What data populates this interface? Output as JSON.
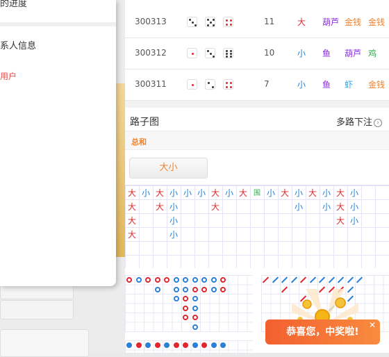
{
  "drawer": {
    "item1": "的进度",
    "item2": "系人信息",
    "item3": "用户"
  },
  "results": [
    {
      "id": "300313",
      "dice": [
        3,
        5,
        4
      ],
      "sum": "11",
      "size": "大",
      "c1": "葫芦",
      "c2": "金钱",
      "c3": "金钱"
    },
    {
      "id": "300312",
      "dice": [
        1,
        3,
        6
      ],
      "sum": "10",
      "size": "小",
      "c1": "鱼",
      "c2": "葫芦",
      "c3": "鸡"
    },
    {
      "id": "300311",
      "dice": [
        1,
        2,
        4
      ],
      "sum": "7",
      "size": "小",
      "c1": "鱼",
      "c2": "虾",
      "c3": "金钱"
    }
  ],
  "roadmap": {
    "title": "路子图",
    "multi": "多路下注",
    "tab": "总和",
    "filter": "大小"
  },
  "big_road": [
    [
      "大",
      "大",
      "大",
      "大"
    ],
    [
      "小"
    ],
    [
      "大",
      "大"
    ],
    [
      "小",
      "小",
      "小",
      "小"
    ],
    [
      "小"
    ],
    [
      "小"
    ],
    [
      "大",
      "大"
    ],
    [
      "小"
    ],
    [
      "大"
    ],
    [
      "围"
    ],
    [
      "小"
    ],
    [
      "大"
    ],
    [
      "小",
      "小"
    ],
    [
      "大"
    ],
    [
      "小",
      "小"
    ],
    [
      "大",
      "大",
      "大"
    ],
    [
      "小",
      "小",
      "小"
    ]
  ],
  "colors": {
    "big": "#e2262d",
    "small": "#2a7fd6",
    "tie": "#2bb04a",
    "fish": "#8a2be2",
    "gold": "#f0812a",
    "shrimp": "#2aa4e8",
    "chicken": "#2bb04a"
  },
  "toast": {
    "text": "恭喜您，中奖啦!",
    "close": "✕"
  }
}
